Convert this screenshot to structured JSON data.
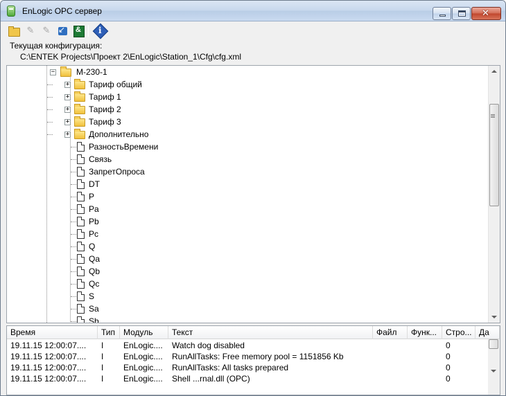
{
  "window": {
    "title": "EnLogic OPC сервер",
    "icons": {
      "min": "minimize-icon",
      "max": "maximize-icon",
      "close": "close-icon",
      "app": "app-icon"
    }
  },
  "toolbar": {
    "buttons": [
      {
        "icon": "open-folder-icon",
        "enabled": true
      },
      {
        "icon": "plug-connect-icon",
        "enabled": false
      },
      {
        "icon": "plug-disconnect-icon",
        "enabled": false
      },
      {
        "icon": "back-arrow-icon",
        "enabled": true
      },
      {
        "icon": "exit-icon",
        "enabled": true
      },
      {
        "icon": "info-icon",
        "enabled": true
      }
    ]
  },
  "config": {
    "label": "Текущая конфигурация:",
    "path": "C:\\ENTEK Projects\\Проект 2\\EnLogic\\Station_1\\Cfg\\cfg.xml"
  },
  "tree": {
    "root": {
      "label": "M-230-1",
      "toggle": "−"
    },
    "folders": [
      {
        "label": "Тариф общий",
        "toggle": "+"
      },
      {
        "label": "Тариф 1",
        "toggle": "+"
      },
      {
        "label": "Тариф 2",
        "toggle": "+"
      },
      {
        "label": "Тариф 3",
        "toggle": "+"
      },
      {
        "label": "Дополнительно",
        "toggle": "+"
      }
    ],
    "items": [
      "РазностьВремени",
      "Связь",
      "ЗапретОпроса",
      "DT",
      "P",
      "Pa",
      "Pb",
      "Pc",
      "Q",
      "Qa",
      "Qb",
      "Qc",
      "S",
      "Sa",
      "Sb"
    ]
  },
  "log": {
    "columns": [
      "Время",
      "Тип",
      "Модуль",
      "Текст",
      "Файл",
      "Функ...",
      "Стро...",
      "Да"
    ],
    "rows": [
      [
        "19.11.15 12:00:07....",
        "I",
        "EnLogic....",
        "Watch dog disabled",
        "",
        "",
        "0"
      ],
      [
        "19.11.15 12:00:07....",
        "I",
        "EnLogic....",
        "RunAllTasks: Free memory pool = 1151856 Kb",
        "",
        "",
        "0"
      ],
      [
        "19.11.15 12:00:07....",
        "I",
        "EnLogic....",
        "RunAllTasks: All tasks prepared",
        "",
        "",
        "0"
      ],
      [
        "19.11.15 12:00:07....",
        "I",
        "EnLogic....",
        "Shell ...rnal.dll (OPC)",
        "",
        "",
        "0"
      ]
    ]
  },
  "colors": {
    "titlebar": "#c7d7ec",
    "folder": "#f1c13c",
    "panel": "#f0f0f0"
  }
}
